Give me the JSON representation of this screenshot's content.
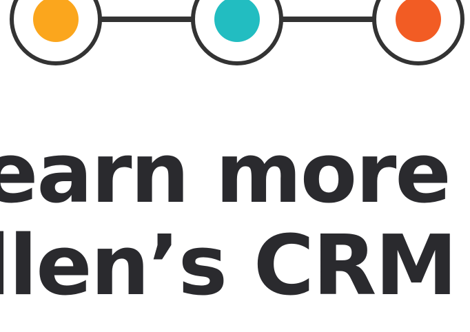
{
  "steps": [
    {
      "name": "step-1",
      "color": "#FBA61D"
    },
    {
      "name": "step-2",
      "color": "#22BDC1"
    },
    {
      "name": "step-3",
      "color": "#F25C24"
    }
  ],
  "ring_color": "#333333",
  "headline": {
    "line1": "earn more ab",
    "line2": "llen’s CRM Ex",
    "line3": ""
  },
  "text_color": "#2a2a2e"
}
